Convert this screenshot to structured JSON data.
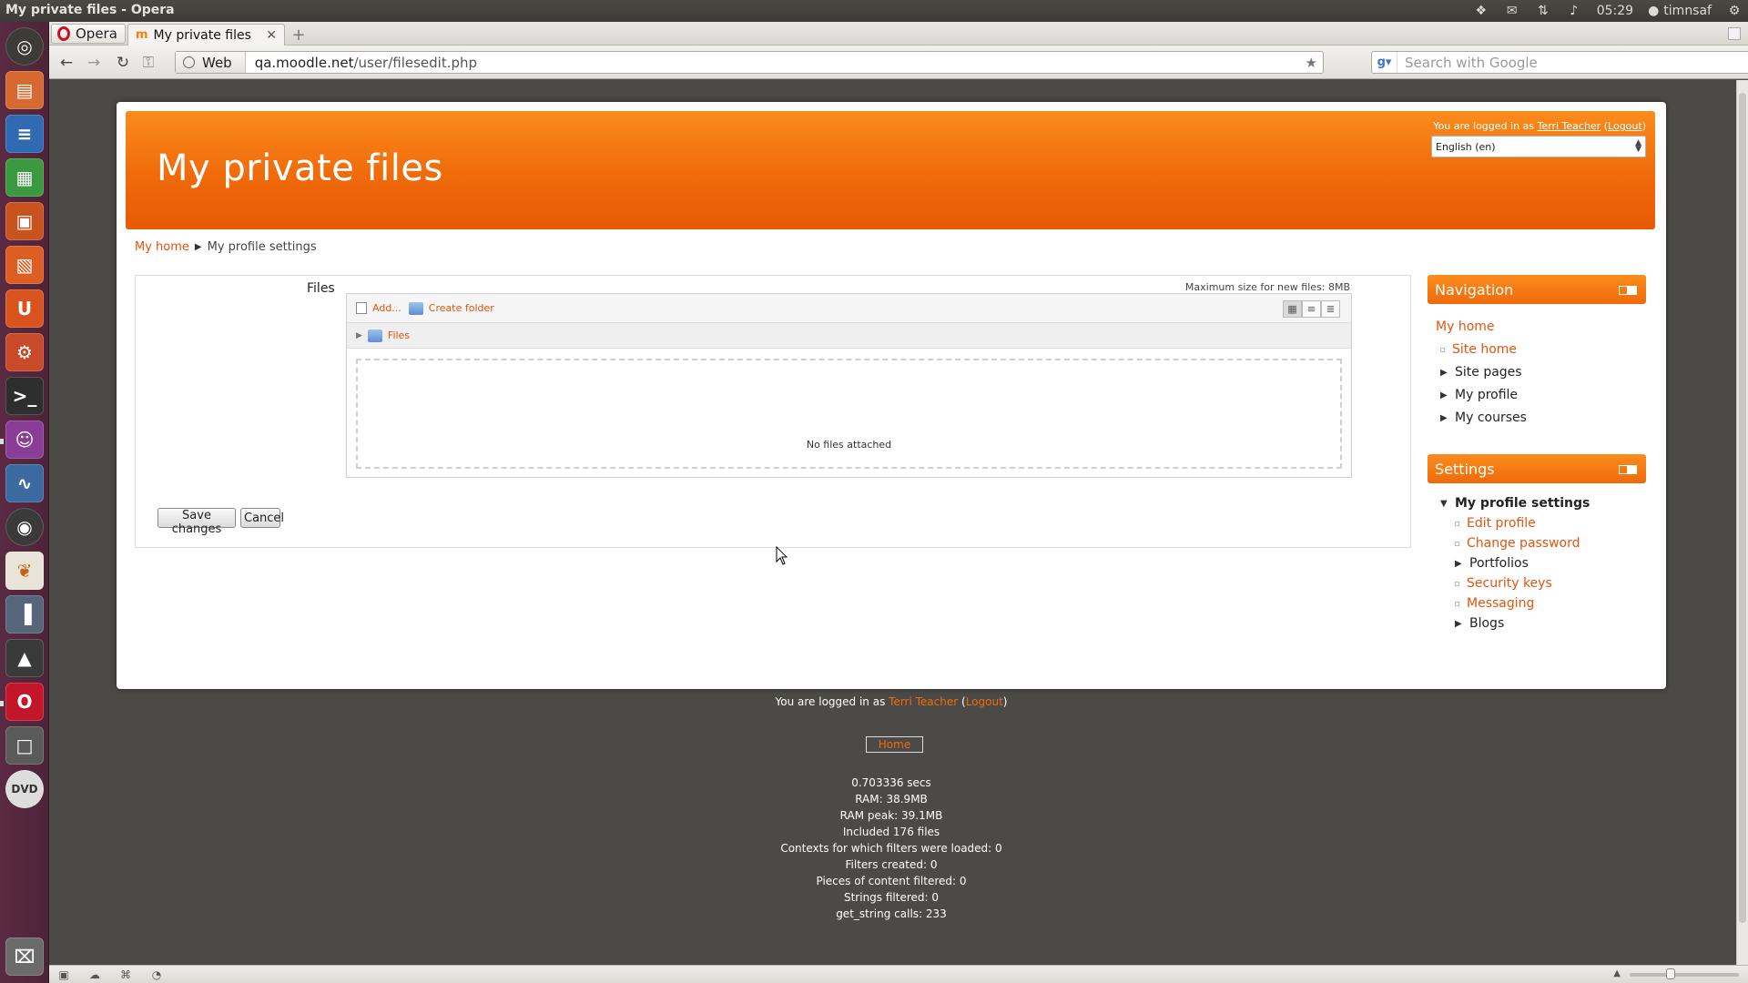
{
  "window": {
    "title": "My private files - Opera",
    "clock": "05:29",
    "user": "timnsaf"
  },
  "launcher": {
    "icons": [
      "ubuntu-dash-icon",
      "files-icon",
      "writer-icon",
      "calc-icon",
      "impress-icon",
      "software-center-icon",
      "ubuntu-one-icon",
      "settings-icon",
      "terminal-icon",
      "pidgin-icon",
      "system-monitor-icon",
      "chrome-icon",
      "butterfly-icon",
      "books-icon",
      "inkscape-icon",
      "opera-icon",
      "workspace-icon",
      "dvd-icon",
      "trash-icon"
    ]
  },
  "browser": {
    "menu_label": "Opera",
    "tab_title": "My private files",
    "url_badge": "Web",
    "url_host": "qa.moodle.net",
    "url_path": "/user/filesedit.php",
    "search_placeholder": "Search with Google"
  },
  "page": {
    "title": "My private files",
    "login_prefix": "You are logged in as",
    "user_name": "Terri Teacher",
    "logout_label": "Logout",
    "language": "English (en)",
    "breadcrumb": {
      "home": "My home",
      "current": "My profile settings"
    },
    "form": {
      "files_label": "Files",
      "max_size": "Maximum size for new files: 8MB",
      "add_label": "Add...",
      "create_folder_label": "Create folder",
      "path_folder": "Files",
      "empty_text": "No files attached",
      "save_label": "Save changes",
      "cancel_label": "Cancel"
    }
  },
  "navigation": {
    "title": "Navigation",
    "items": [
      "My home",
      "Site home",
      "Site pages",
      "My profile",
      "My courses"
    ]
  },
  "settings": {
    "title": "Settings",
    "root": "My profile settings",
    "items": [
      "Edit profile",
      "Change password",
      "Portfolios",
      "Security keys",
      "Messaging",
      "Blogs"
    ]
  },
  "footer": {
    "login_prefix": "You are logged in as",
    "user_name": "Terri Teacher",
    "logout_label": "Logout",
    "home_label": "Home",
    "perf": [
      "0.703336 secs",
      "RAM: 38.9MB",
      "RAM peak: 39.1MB",
      "Included 176 files",
      "Contexts for which filters were loaded: 0",
      "Filters created: 0",
      "Pieces of content filtered: 0",
      "Strings filtered: 0",
      "get_string calls: 233"
    ]
  },
  "colors": {
    "brand": "#f06a0a",
    "link": "#e3530d",
    "launcher": "#4e2438"
  }
}
